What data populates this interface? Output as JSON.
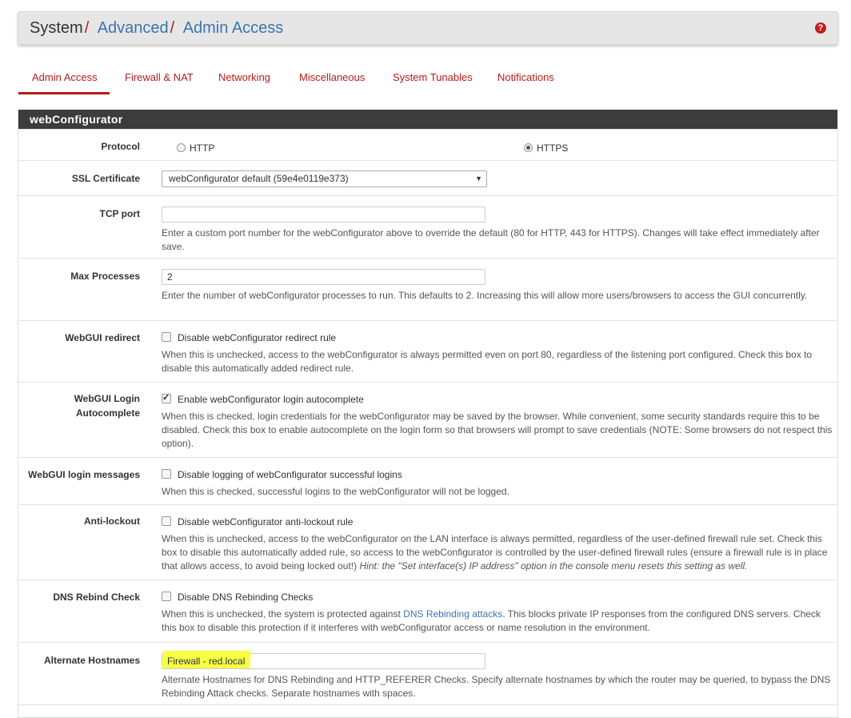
{
  "breadcrumb": {
    "root": "System",
    "advanced": "Advanced",
    "current": "Admin Access"
  },
  "tabs": [
    {
      "label": "Admin Access",
      "active": true
    },
    {
      "label": "Firewall & NAT",
      "active": false
    },
    {
      "label": "Networking",
      "active": false
    },
    {
      "label": "Miscellaneous",
      "active": false
    },
    {
      "label": "System Tunables",
      "active": false
    },
    {
      "label": "Notifications",
      "active": false
    }
  ],
  "colors": {
    "accent": "#b71c1c",
    "link": "#3a75b0",
    "panel_head": "#3c3c3c",
    "highlight": "#f7ff45"
  },
  "panel": {
    "title": "webConfigurator"
  },
  "protocol": {
    "label": "Protocol",
    "opt_http": "HTTP",
    "opt_https": "HTTPS",
    "selected": "HTTPS"
  },
  "ssl": {
    "label": "SSL Certificate",
    "value": "webConfigurator default (59e4e0119e373)"
  },
  "tcp_port": {
    "label": "TCP port",
    "value": "",
    "help": "Enter a custom port number for the webConfigurator above to override the default (80 for HTTP, 443 for HTTPS). Changes will take effect immediately after save."
  },
  "max_processes": {
    "label": "Max Processes",
    "value": "2",
    "help": "Enter the number of webConfigurator processes to run. This defaults to 2. Increasing this will allow more users/browsers to access the GUI concurrently."
  },
  "redirect": {
    "label": "WebGUI redirect",
    "checkbox": "Disable webConfigurator redirect rule",
    "checked": false,
    "help": "When this is unchecked, access to the webConfigurator is always permitted even on port 80, regardless of the listening port configured. Check this box to disable this automatically added redirect rule."
  },
  "autocomplete": {
    "label_line1": "WebGUI Login",
    "label_line2": "Autocomplete",
    "checkbox": "Enable webConfigurator login autocomplete",
    "checked": true,
    "help": "When this is checked, login credentials for the webConfigurator may be saved by the browser. While convenient, some security standards require this to be disabled. Check this box to enable autocomplete on the login form so that browsers will prompt to save credentials (NOTE: Some browsers do not respect this option)."
  },
  "login_messages": {
    "label": "WebGUI login messages",
    "checkbox": "Disable logging of webConfigurator successful logins",
    "checked": false,
    "help": "When this is checked, successful logins to the webConfigurator will not be logged."
  },
  "antilockout": {
    "label": "Anti-lockout",
    "checkbox": "Disable webConfigurator anti-lockout rule",
    "checked": false,
    "help": "When this is unchecked, access to the webConfigurator on the LAN interface is always permitted, regardless of the user-defined firewall rule set. Check this box to disable this automatically added rule, so access to the webConfigurator is controlled by the user-defined firewall rules (ensure a firewall rule is in place that allows access, to avoid being locked out!)",
    "hint": "Hint: the \"Set interface(s) IP address\" option in the console menu resets this setting as well."
  },
  "dns_rebind": {
    "label": "DNS Rebind Check",
    "checkbox": "Disable DNS Rebinding Checks",
    "checked": false,
    "help_pre": "When this is unchecked, the system is protected against ",
    "help_link": "DNS Rebinding attacks",
    "help_post": ". This blocks private IP responses from the configured DNS servers. Check this box to disable this protection if it interferes with webConfigurator access or name resolution in the environment."
  },
  "alt_hostnames": {
    "label": "Alternate Hostnames",
    "value": "Firewall - red.local",
    "help": "Alternate Hostnames for DNS Rebinding and HTTP_REFERER Checks. Specify alternate hostnames by which the router may be queried, to bypass the DNS Rebinding Attack checks. Separate hostnames with spaces."
  }
}
